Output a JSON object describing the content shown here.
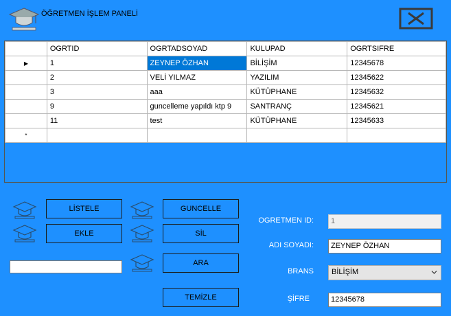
{
  "window": {
    "title": "ÖĞRETMEN İŞLEM PANELİ"
  },
  "grid": {
    "columns": [
      "OGRTID",
      "OGRTADSOYAD",
      "KULUPAD",
      "OGRTSIFRE"
    ],
    "rows": [
      [
        "1",
        "ZEYNEP ÖZHAN",
        "BİLİŞİM",
        "12345678"
      ],
      [
        "2",
        "VELİ YILMAZ",
        "YAZILIM",
        "12345622"
      ],
      [
        "3",
        "aaa",
        "KÜTÜPHANE",
        "12345632"
      ],
      [
        "9",
        "guncelleme yapıldı ktp 9",
        "SANTRANÇ",
        "12345621"
      ],
      [
        "11",
        "test",
        "KÜTÜPHANE",
        "12345633"
      ]
    ],
    "current_row_marker": "▶",
    "new_row_marker": "*"
  },
  "buttons": {
    "listele": "LİSTELE",
    "ekle": "EKLE",
    "guncelle": "GUNCELLE",
    "sil": "SİL",
    "ara": "ARA",
    "temizle": "TEMİZLE"
  },
  "search": {
    "value": ""
  },
  "form": {
    "id_label": "OGRETMEN ID:",
    "id_value": "1",
    "name_label": "ADI SOYADI:",
    "name_value": "ZEYNEP ÖZHAN",
    "brans_label": "BRANS",
    "brans_value": "BİLİŞİM",
    "password_label": "ŞİFRE",
    "password_value": "12345678"
  },
  "colors": {
    "background": "#1e90ff",
    "selection": "#0078d7"
  },
  "icons": [
    "graduation-cap-icon",
    "close-icon"
  ]
}
